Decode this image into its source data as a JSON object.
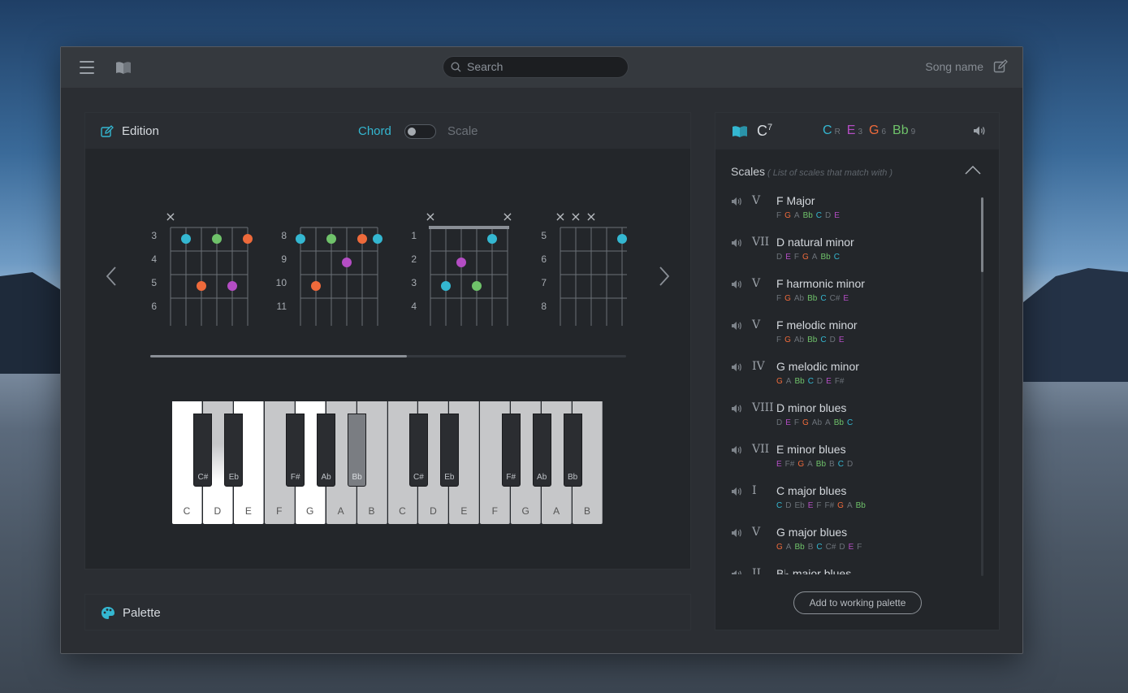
{
  "topbar": {
    "search_placeholder": "Search",
    "song_name": "Song name"
  },
  "edition": {
    "title": "Edition",
    "mode_chord": "Chord",
    "mode_scale": "Scale",
    "diagrams": [
      {
        "frets": [
          "3",
          "4",
          "5",
          "6"
        ],
        "markers": [
          "×"
        ]
      },
      {
        "frets": [
          "8",
          "9",
          "10",
          "11"
        ],
        "markers": []
      },
      {
        "frets": [
          "1",
          "2",
          "3",
          "4"
        ],
        "markers": [
          "×",
          "×"
        ]
      },
      {
        "frets": [
          "5",
          "6",
          "7",
          "8"
        ],
        "markers": [
          "×",
          "×",
          "×"
        ]
      }
    ],
    "scroll_fraction": 0.54,
    "piano": {
      "white_keys": [
        "C",
        "D",
        "E",
        "F",
        "G",
        "A",
        "B",
        "C",
        "D",
        "E",
        "F",
        "G",
        "A",
        "B"
      ],
      "white_state": [
        "lit",
        "grey",
        "lit",
        "grey",
        "lit",
        "grey",
        "grey",
        "grey",
        "grey",
        "grey",
        "grey",
        "grey",
        "grey",
        "grey"
      ],
      "black_keys": [
        "C#",
        "Eb",
        "F#",
        "Ab",
        "Bb",
        "C#",
        "Eb",
        "F#",
        "Ab",
        "Bb"
      ],
      "selected_black": "Bb"
    }
  },
  "palette": {
    "title": "Palette"
  },
  "chord": {
    "root": "C",
    "quality": "7",
    "notes": [
      {
        "note": "C",
        "interval": "R",
        "color": "#34b7d1"
      },
      {
        "note": "E",
        "interval": "3",
        "color": "#b44dc4"
      },
      {
        "note": "G",
        "interval": "6",
        "color": "#ee6a3b"
      },
      {
        "note": "Bb",
        "interval": "9",
        "color": "#6fc26a"
      }
    ]
  },
  "scales": {
    "title": "Scales",
    "subtitle": "( List of scales that match with )",
    "items": [
      {
        "degree": "V",
        "name": "F Major",
        "notes": [
          "F",
          "G",
          "A",
          "Bb",
          "C",
          "D",
          "E"
        ]
      },
      {
        "degree": "VII",
        "name": "D natural minor",
        "notes": [
          "D",
          "E",
          "F",
          "G",
          "A",
          "Bb",
          "C"
        ]
      },
      {
        "degree": "V",
        "name": "F harmonic minor",
        "notes": [
          "F",
          "G",
          "Ab",
          "Bb",
          "C",
          "C#",
          "E"
        ]
      },
      {
        "degree": "V",
        "name": "F melodic minor",
        "notes": [
          "F",
          "G",
          "Ab",
          "Bb",
          "C",
          "D",
          "E"
        ]
      },
      {
        "degree": "IV",
        "name": "G melodic minor",
        "notes": [
          "G",
          "A",
          "Bb",
          "C",
          "D",
          "E",
          "F#"
        ]
      },
      {
        "degree": "VIII",
        "name": "D minor blues",
        "notes": [
          "D",
          "E",
          "F",
          "G",
          "Ab",
          "A",
          "Bb",
          "C"
        ]
      },
      {
        "degree": "VII",
        "name": "E minor blues",
        "notes": [
          "E",
          "F#",
          "G",
          "A",
          "Bb",
          "B",
          "C",
          "D"
        ]
      },
      {
        "degree": "I",
        "name": "C major blues",
        "notes": [
          "C",
          "D",
          "Eb",
          "E",
          "F",
          "F#",
          "G",
          "A",
          "Bb"
        ]
      },
      {
        "degree": "V",
        "name": "G major blues",
        "notes": [
          "G",
          "A",
          "Bb",
          "B",
          "C",
          "C#",
          "D",
          "E",
          "F"
        ]
      },
      {
        "degree": "II",
        "name": "B♭ major blues",
        "notes": []
      }
    ],
    "add_button": "Add to working palette"
  },
  "colors": {
    "C": "#34b7d1",
    "E": "#b44dc4",
    "G": "#ee6a3b",
    "Bb": "#6fc26a",
    "other": "#6c7279"
  }
}
